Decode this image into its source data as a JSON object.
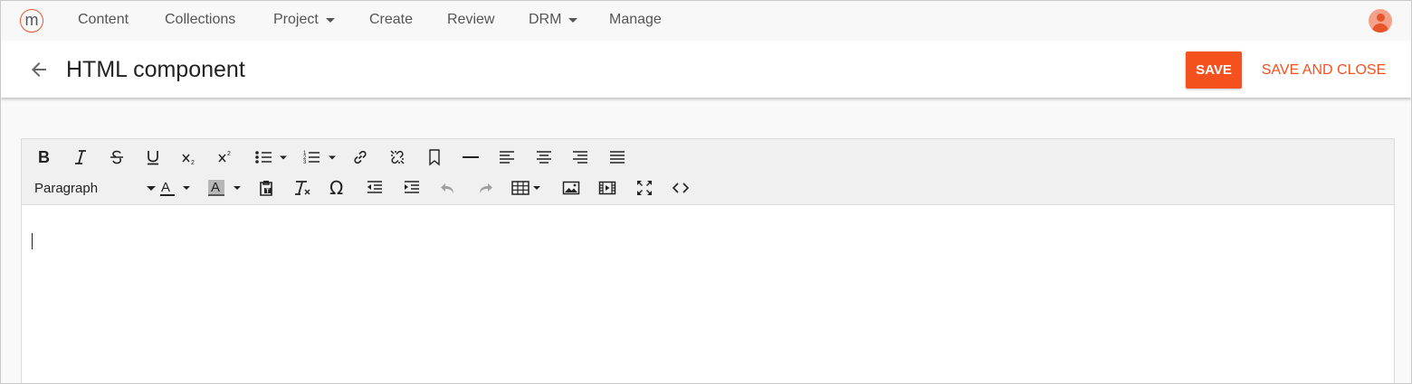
{
  "logo": {
    "letter": "m",
    "accent": "#e8552b"
  },
  "nav": {
    "items": [
      {
        "label": "Content",
        "dropdown": false
      },
      {
        "label": "Collections",
        "dropdown": false
      },
      {
        "label": "Project",
        "dropdown": true
      },
      {
        "label": "Create",
        "dropdown": false
      },
      {
        "label": "Review",
        "dropdown": false
      },
      {
        "label": "DRM",
        "dropdown": true
      },
      {
        "label": "Manage",
        "dropdown": false
      }
    ],
    "avatar_icon": "user-avatar-icon"
  },
  "header": {
    "back_icon": "arrow-left-icon",
    "title": "HTML component",
    "save_label": "SAVE",
    "save_close_label": "SAVE AND CLOSE",
    "accent": "#f4511e"
  },
  "editor": {
    "block_format": "Paragraph",
    "toolbar_row1": [
      "bold-icon",
      "italic-icon",
      "strikethrough-icon",
      "underline-icon",
      "subscript-icon",
      "superscript-icon",
      "bullet-list-icon",
      "numbered-list-icon",
      "link-icon",
      "unlink-icon",
      "bookmark-icon",
      "horizontal-rule-icon",
      "align-left-icon",
      "align-center-icon",
      "align-right-icon",
      "align-justify-icon"
    ],
    "toolbar_row2": [
      "text-color-icon",
      "background-color-icon",
      "paste-text-icon",
      "clear-formatting-icon",
      "special-character-icon",
      "outdent-icon",
      "indent-icon",
      "undo-icon",
      "redo-icon",
      "table-icon",
      "image-icon",
      "media-icon",
      "fullscreen-icon",
      "source-code-icon"
    ],
    "content": ""
  }
}
